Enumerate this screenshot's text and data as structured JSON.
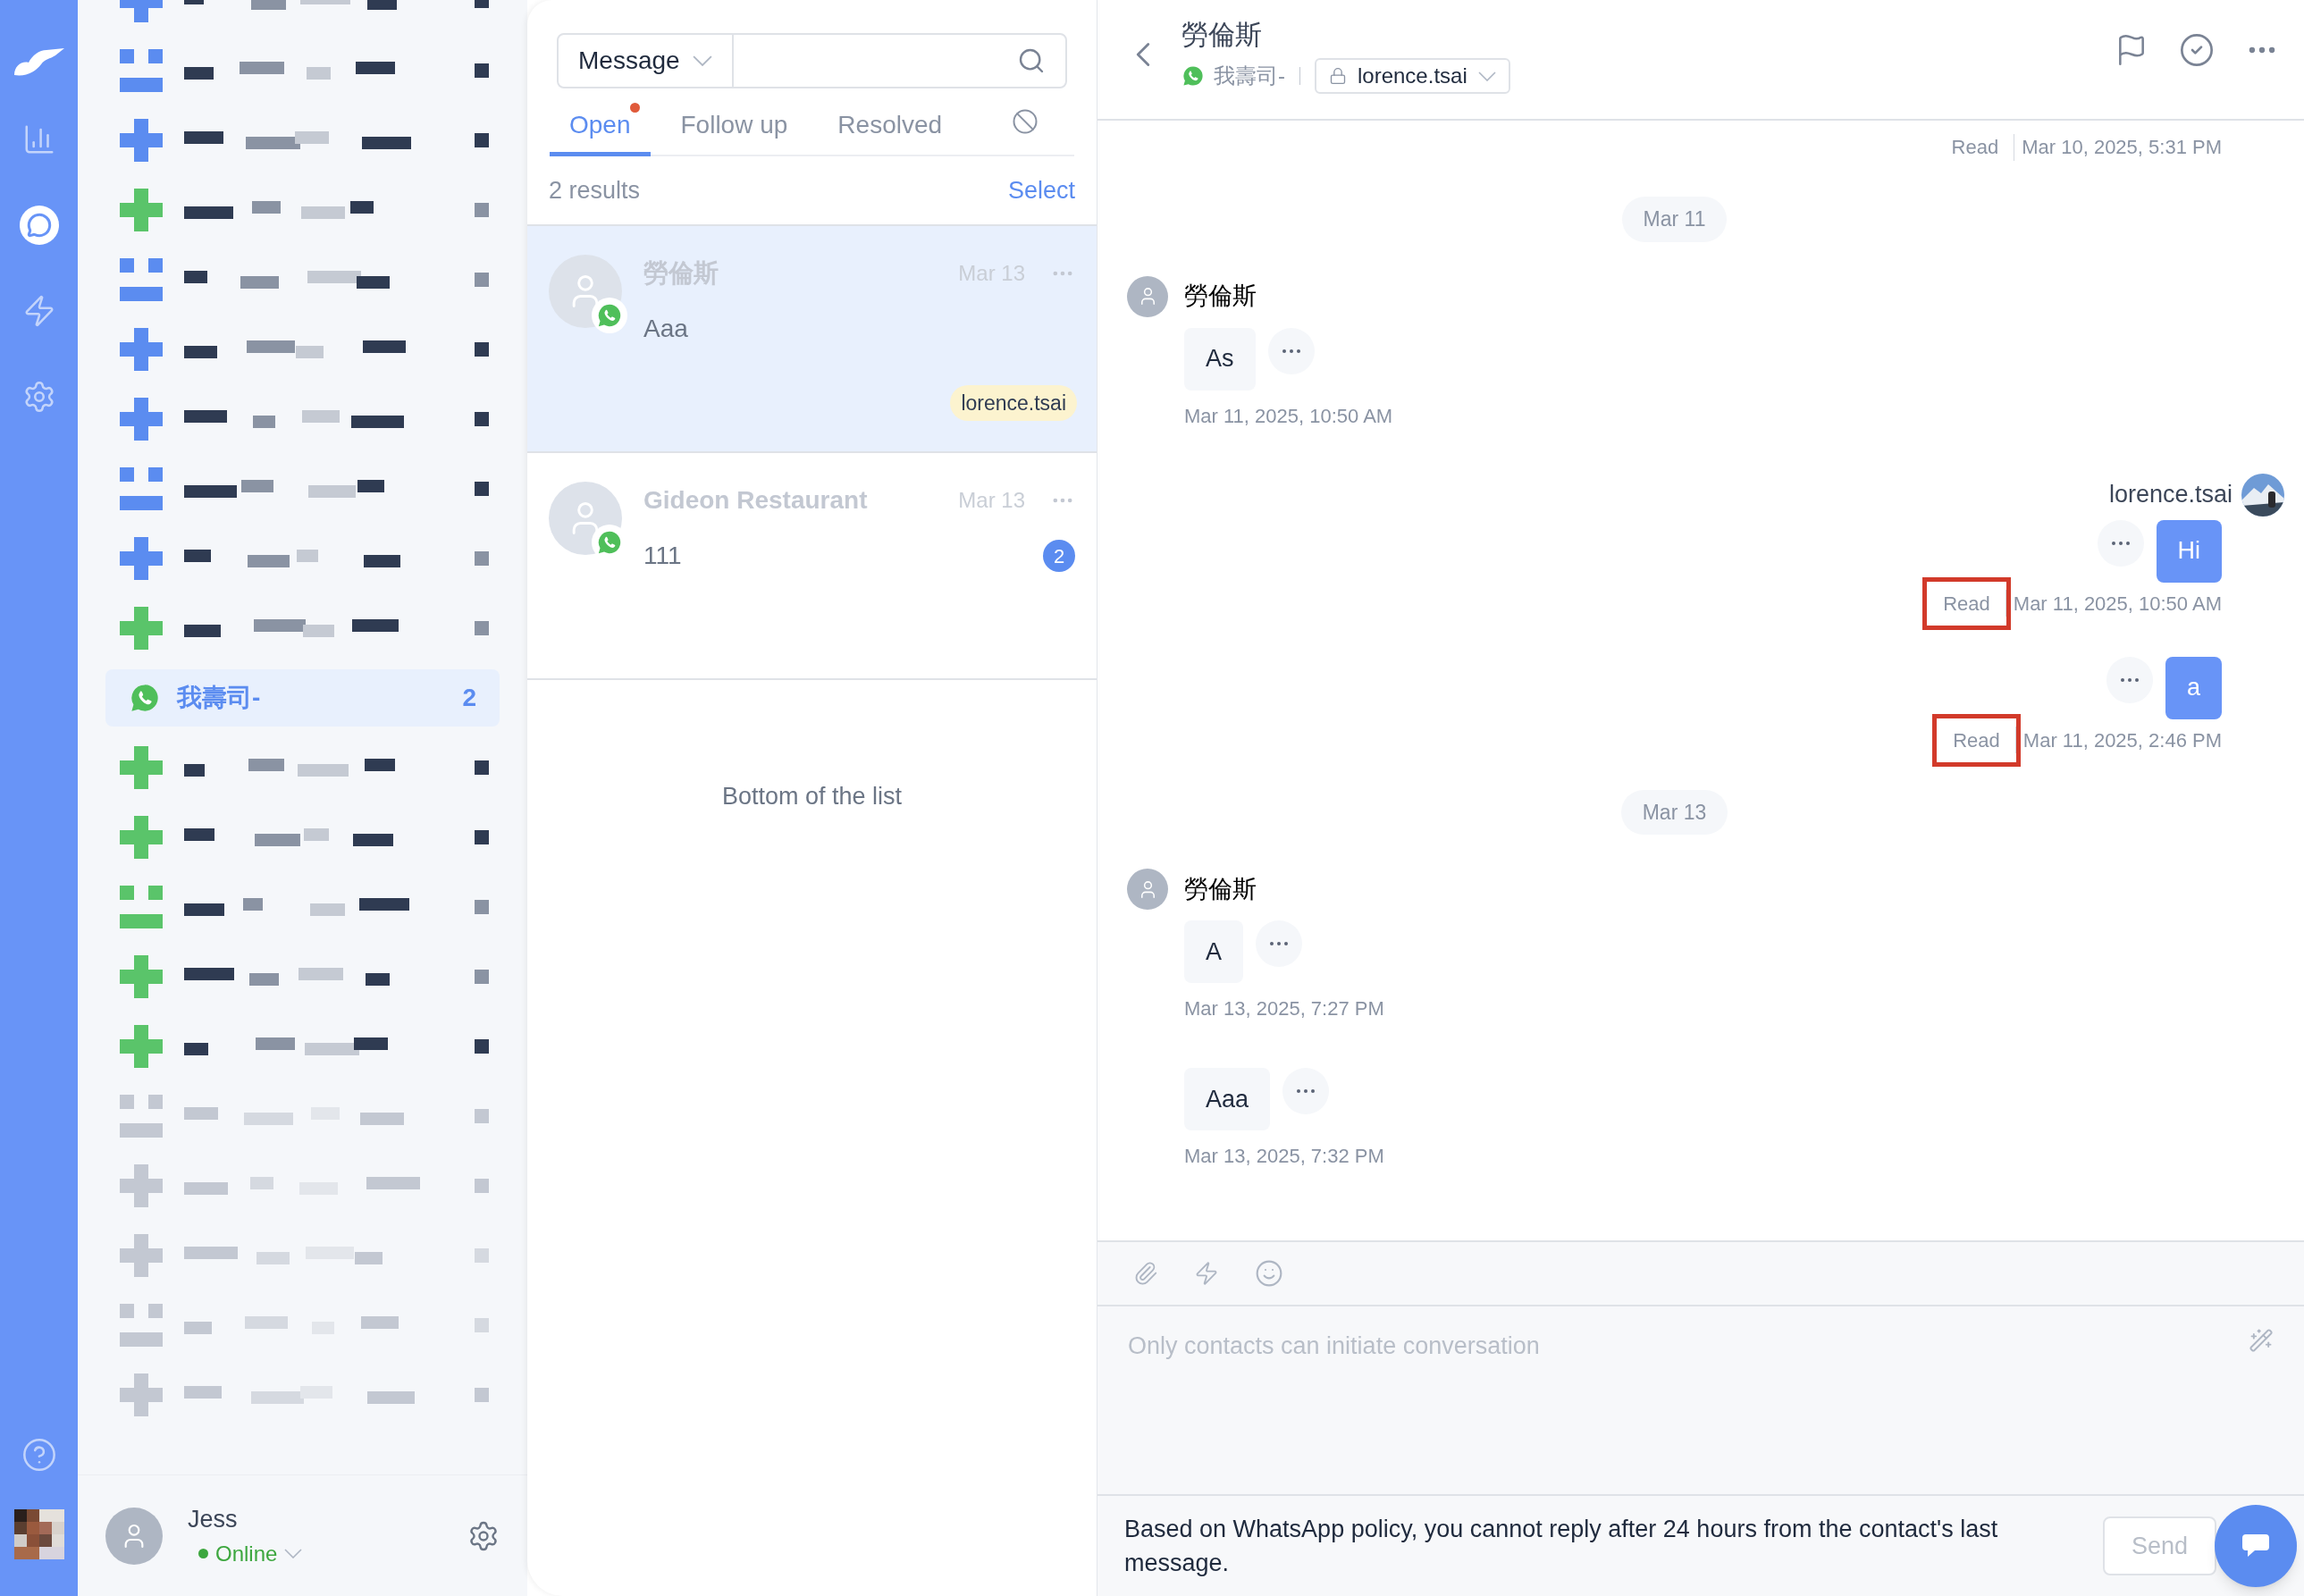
{
  "nav": {
    "items": [
      {
        "kind": "reports",
        "selected": false
      },
      {
        "kind": "chat",
        "selected": true
      },
      {
        "kind": "automation",
        "selected": false
      },
      {
        "kind": "settings",
        "selected": false
      }
    ]
  },
  "channels": [
    {
      "kind": "redacted",
      "color": "#5b8cf0",
      "faded": false,
      "selected": false
    },
    {
      "kind": "redacted",
      "color": "#5b8cf0",
      "faded": false,
      "selected": false
    },
    {
      "kind": "redacted",
      "color": "#5b8cf0",
      "faded": false,
      "selected": false
    },
    {
      "kind": "redacted",
      "color": "#5ac46a",
      "faded": false,
      "selected": false
    },
    {
      "kind": "redacted",
      "color": "#5b8cf0",
      "faded": false,
      "selected": false
    },
    {
      "kind": "redacted",
      "color": "#5b8cf0",
      "faded": false,
      "selected": false
    },
    {
      "kind": "redacted",
      "color": "#5b8cf0",
      "faded": false,
      "selected": false
    },
    {
      "kind": "redacted",
      "color": "#5b8cf0",
      "faded": false,
      "selected": false
    },
    {
      "kind": "redacted",
      "color": "#5b8cf0",
      "faded": false,
      "selected": false
    },
    {
      "kind": "redacted",
      "color": "#5ac46a",
      "faded": false,
      "selected": false
    },
    {
      "kind": "whatsapp",
      "name": "我壽司-",
      "count": "2",
      "selected": true
    },
    {
      "kind": "redacted",
      "color": "#5ac46a",
      "faded": false,
      "selected": false
    },
    {
      "kind": "redacted",
      "color": "#5ac46a",
      "faded": false,
      "selected": false
    },
    {
      "kind": "redacted",
      "color": "#5ac46a",
      "faded": false,
      "selected": false
    },
    {
      "kind": "redacted",
      "color": "#5ac46a",
      "faded": false,
      "selected": false
    },
    {
      "kind": "redacted",
      "color": "#5ac46a",
      "faded": false,
      "selected": false
    },
    {
      "kind": "redacted",
      "color": "#c3c8d2",
      "faded": true,
      "selected": false
    },
    {
      "kind": "redacted",
      "color": "#c3c8d2",
      "faded": true,
      "selected": false
    },
    {
      "kind": "redacted",
      "color": "#c3c8d2",
      "faded": true,
      "selected": false
    },
    {
      "kind": "redacted",
      "color": "#c3c8d2",
      "faded": true,
      "selected": false
    },
    {
      "kind": "redacted",
      "color": "#c3c8d2",
      "faded": true,
      "selected": false
    }
  ],
  "user": {
    "name": "Jess",
    "status": "Online",
    "online": true
  },
  "conversation_list": {
    "search": {
      "scope": "Message"
    },
    "tabs": [
      {
        "kind": "text",
        "label": "Open",
        "selected": true,
        "dot": true
      },
      {
        "kind": "text",
        "label": "Follow up",
        "selected": false,
        "dot": false
      },
      {
        "kind": "text",
        "label": "Resolved",
        "selected": false,
        "dot": false
      },
      {
        "kind": "blocked",
        "selected": false
      }
    ],
    "results": "2 results",
    "select": "Select",
    "conversations": [
      {
        "name": "勞倫斯",
        "preview": "Aaa",
        "date": "Mar 13",
        "selected": true,
        "tag": "lorence.tsai"
      },
      {
        "name": "Gideon Restaurant",
        "preview": "111",
        "date": "Mar 13",
        "selected": false,
        "unread": "2"
      }
    ],
    "end_text": "Bottom of the list"
  },
  "chat": {
    "header": {
      "title": "勞倫斯",
      "channel": "我壽司-",
      "assignee": "lorence.tsai"
    },
    "messages": [
      {
        "kind": "receipt",
        "status": "Read",
        "time": "Mar 10, 2025, 5:31 PM",
        "highlighted": false
      },
      {
        "kind": "date",
        "label": "Mar 11"
      },
      {
        "kind": "incoming",
        "sender": "勞倫斯",
        "text": "As",
        "time": "Mar 11, 2025, 10:50 AM"
      },
      {
        "kind": "outgoing",
        "sender": "lorence.tsai",
        "text": "Hi",
        "status": "Read",
        "time": "Mar 11, 2025, 10:50 AM",
        "highlighted": true
      },
      {
        "kind": "outgoing",
        "text": "a",
        "status": "Read",
        "time": "Mar 11, 2025, 2:46 PM",
        "highlighted": true
      },
      {
        "kind": "date",
        "label": "Mar 13"
      },
      {
        "kind": "incoming",
        "sender": "勞倫斯",
        "text": "A",
        "time": "Mar 13, 2025, 7:27 PM"
      },
      {
        "kind": "incoming",
        "text": "Aaa",
        "time": "Mar 13, 2025, 7:32 PM"
      }
    ],
    "composer": {
      "placeholder": "Only contacts can initiate conversation",
      "notice": "Based on WhatsApp policy, you cannot reply after 24 hours from the contact's last message.",
      "send": "Send",
      "send_disabled": true
    }
  }
}
